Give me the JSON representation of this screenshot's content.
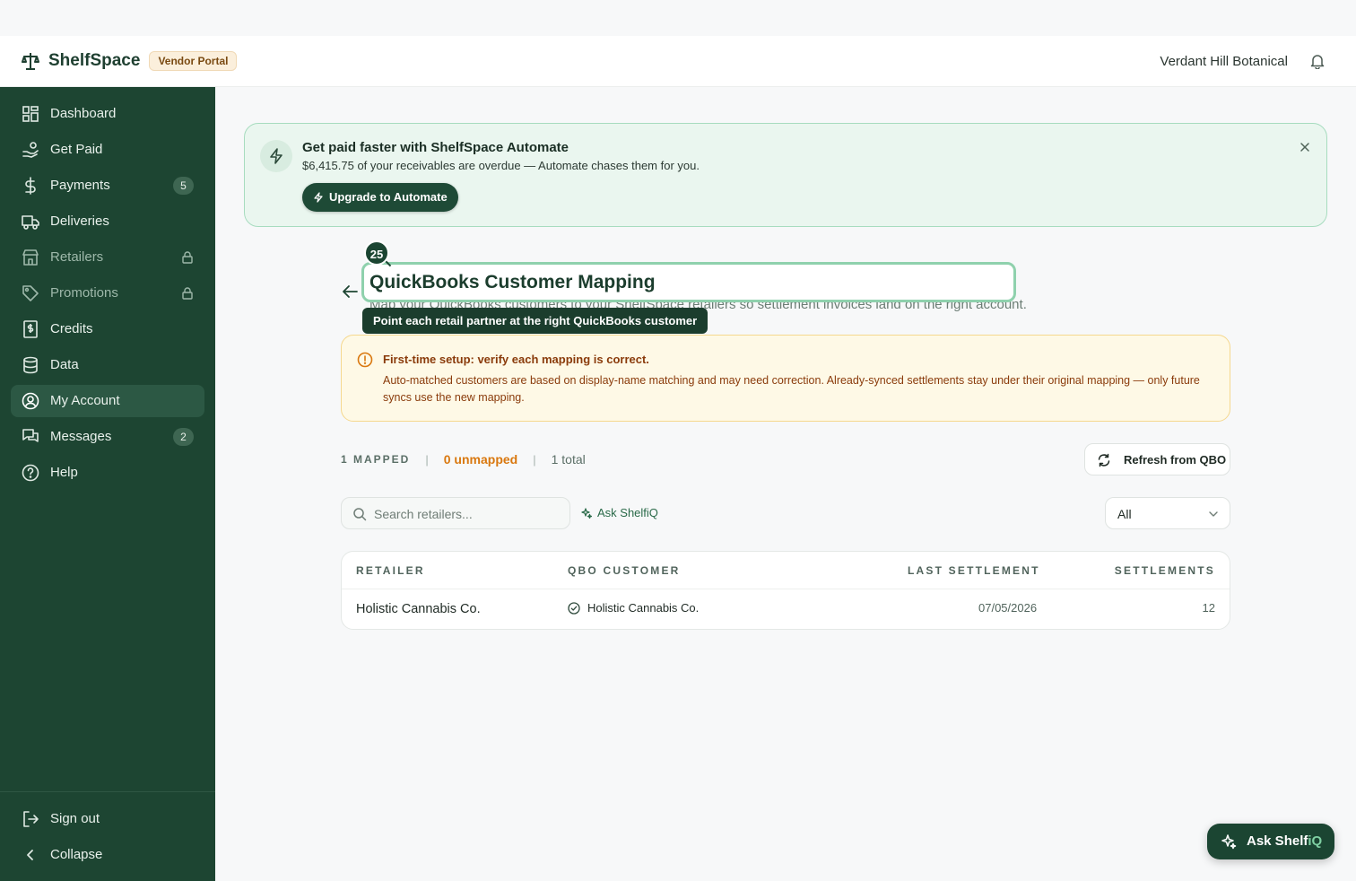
{
  "header": {
    "brand_name": "ShelfSpace",
    "portal_badge": "Vendor Portal",
    "account_name": "Verdant Hill Botanical",
    "brand_icon": "scale-icon",
    "bell_icon": "bell-icon"
  },
  "sidebar": {
    "items": [
      {
        "label": "Dashboard",
        "icon": "grid-icon"
      },
      {
        "label": "Get Paid",
        "icon": "hand-coins-icon"
      },
      {
        "label": "Payments",
        "icon": "dollar-icon",
        "badge": "5"
      },
      {
        "label": "Deliveries",
        "icon": "truck-icon"
      },
      {
        "label": "Retailers",
        "icon": "store-icon",
        "locked": true
      },
      {
        "label": "Promotions",
        "icon": "tag-icon",
        "locked": true
      },
      {
        "label": "Credits",
        "icon": "receipt-icon"
      },
      {
        "label": "Data",
        "icon": "database-icon"
      },
      {
        "label": "My Account",
        "icon": "user-circle-icon",
        "active": true
      },
      {
        "label": "Messages",
        "icon": "chat-icon",
        "badge": "2"
      },
      {
        "label": "Help",
        "icon": "help-icon"
      }
    ],
    "sign_out": "Sign out",
    "collapse": "Collapse"
  },
  "promo": {
    "title": "Get paid faster with ShelfSpace Automate",
    "subtitle": "$6,415.75 of your receivables are overdue — Automate chases them for you.",
    "button": "Upgrade to Automate"
  },
  "page": {
    "title": "QuickBooks Customer Mapping",
    "subtitle": "Map your QuickBooks customers to your ShelfSpace retailers so settlement invoices land on the right account.",
    "step_number": "25",
    "tooltip": "Point each retail partner at the right QuickBooks customer"
  },
  "warning": {
    "title": "First-time setup: verify each mapping is correct.",
    "body": "Auto-matched customers are based on display-name matching and may need correction. Already-synced settlements stay under their original mapping — only future syncs use the new mapping."
  },
  "stats": {
    "mapped": "1 MAPPED",
    "unmapped": "0 unmapped",
    "total": "1 total"
  },
  "toolbar": {
    "refresh": "Refresh from QBO",
    "search_placeholder": "Search retailers...",
    "ask": "Ask ShelfiQ",
    "filter": "All"
  },
  "table": {
    "columns": [
      "RETAILER",
      "QBO CUSTOMER",
      "LAST SETTLEMENT",
      "SETTLEMENTS"
    ],
    "rows": [
      {
        "retailer": "Holistic Cannabis Co.",
        "qbo_customer": "Holistic Cannabis Co.",
        "last_settlement": "07/05/2026",
        "settlements": "12"
      }
    ]
  },
  "ask_float": {
    "prefix": "Ask Shelf",
    "suffix": "iQ"
  },
  "colors": {
    "sidebar_bg": "#1d4532",
    "accent": "#1b4532",
    "unmapped": "#d9780f",
    "warning_text": "#8a3b0b"
  }
}
